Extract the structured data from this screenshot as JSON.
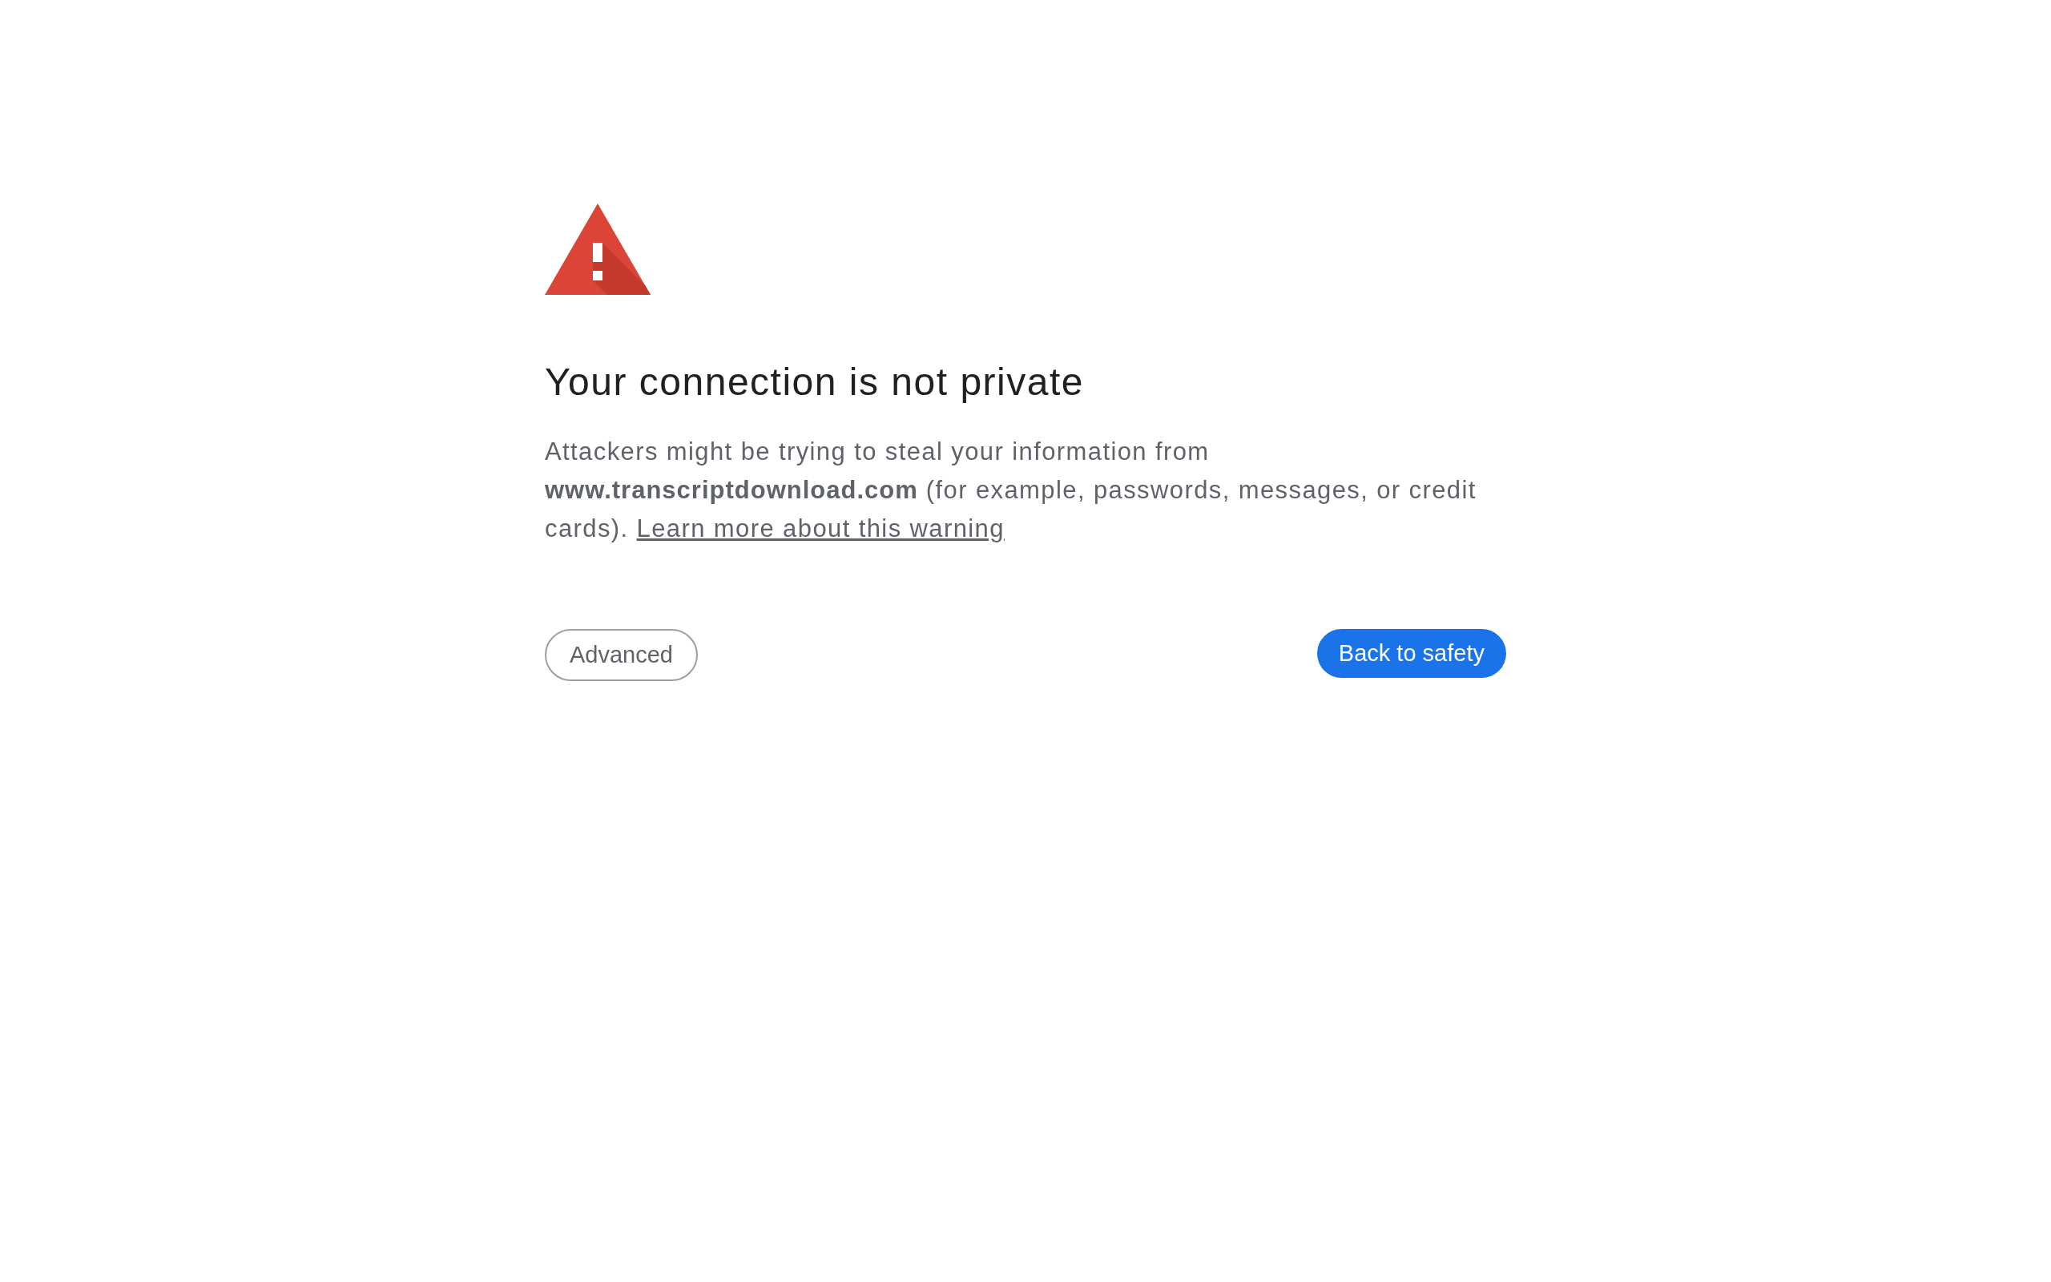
{
  "heading": "Your connection is not private",
  "message": {
    "text": "Attackers might be trying to steal your information from **www.transcriptdownload.com** (for example, passwords, messages, or credit cards).",
    "link": "Learn more about this warning"
  },
  "buttons": [
    {
      "label": "Advanced",
      "kind": "secondary"
    },
    {
      "label": "Back to safety",
      "kind": "primary"
    }
  ]
}
